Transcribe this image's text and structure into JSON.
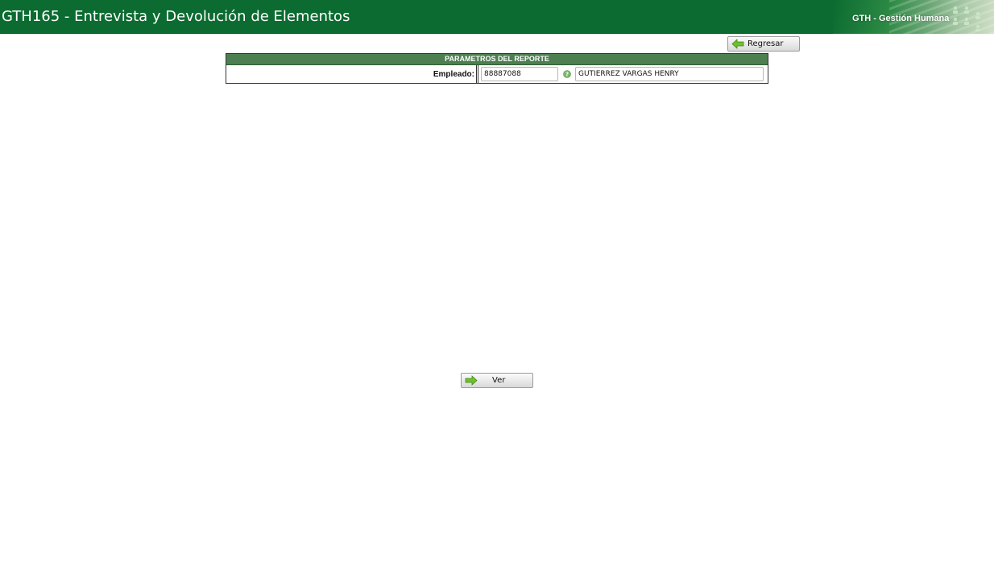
{
  "header": {
    "title": "GTH165 - Entrevista y Devolución de Elementos",
    "brand": "GTH - Gestión Humana",
    "brand_icon": "people-icon"
  },
  "toolbar": {
    "back_label": "Regresar",
    "back_icon": "arrow-left-icon"
  },
  "params": {
    "title": "PARAMETROS DEL REPORTE",
    "employee_label": "Empleado:",
    "employee_code": "88887088",
    "employee_name": "GUTIERREZ VARGAS  HENRY",
    "help_icon": "help-icon"
  },
  "actions": {
    "view_label": "Ver",
    "view_icon": "arrow-right-icon"
  },
  "colors": {
    "header_bg": "#0b6b30",
    "section_header_bg": "#4d7f51",
    "arrow_green": "#6fbf2e"
  }
}
